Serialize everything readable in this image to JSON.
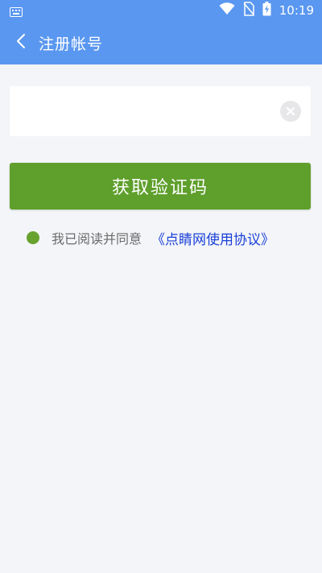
{
  "status_bar": {
    "time": "10:19",
    "icons": [
      "keyboard-icon",
      "wifi-icon",
      "no-sim-icon",
      "battery-charging-icon"
    ]
  },
  "app_bar": {
    "title": "注册帐号",
    "back_icon": "chevron-left-icon"
  },
  "form": {
    "phone_value": "",
    "phone_placeholder": "",
    "clear_icon": "clear-circle-icon",
    "submit_label": "获取验证码"
  },
  "agreement": {
    "text": "我已阅读并同意",
    "link": "《点睛网使用协议》"
  },
  "colors": {
    "primary": "#5a97f0",
    "button": "#5f9f2c",
    "link": "#1b40d8",
    "background": "#f3f5f8"
  }
}
